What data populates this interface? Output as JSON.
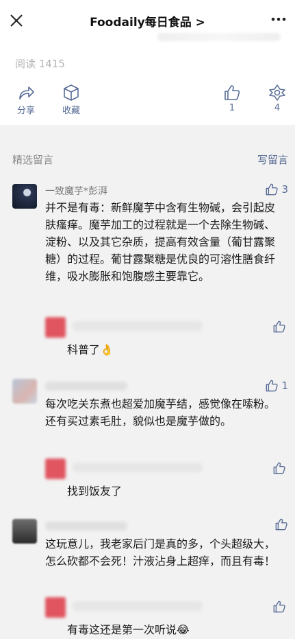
{
  "header": {
    "title": "Foodaily每日食品 >",
    "close_icon": "close-icon",
    "more_icon": "more-icon"
  },
  "stats": {
    "reads": "阅读 1415"
  },
  "actions": {
    "share": "分享",
    "favorite": "收藏",
    "like_count": "1",
    "wow_count": "4"
  },
  "comments_section": {
    "title": "精选留言",
    "write": "写留言"
  },
  "comments": [
    {
      "author": "一致魔芋*彭湃",
      "likes": "3",
      "text": "并不是有毒：新鲜魔芋中含有生物碱，会引起皮肤瘙痒。魔芋加工的过程就是一个去除生物碱、淀粉、以及其它杂质，提高有效含量（葡甘露聚糖）的过程。葡甘露聚糖是优良的可溶性膳食纤维，吸水膨胀和饱腹感主要靠它。",
      "reply": "科普了👌"
    },
    {
      "author": "",
      "likes": "1",
      "text": "每次吃关东煮也超爱加魔芋结，感觉像在嗦粉。还有买过素毛肚，貌似也是魔芋做的。",
      "reply": "找到饭友了"
    },
    {
      "author": "",
      "likes": "",
      "text": "这玩意儿，我老家后门是真的多，个头超级大，怎么砍都不会死！汁液沾身上超痒，而且有毒！",
      "reply": "有毒这还是第一次听说😂"
    }
  ],
  "colors": {
    "link": "#576b95",
    "bg": "#f2f2f2"
  }
}
